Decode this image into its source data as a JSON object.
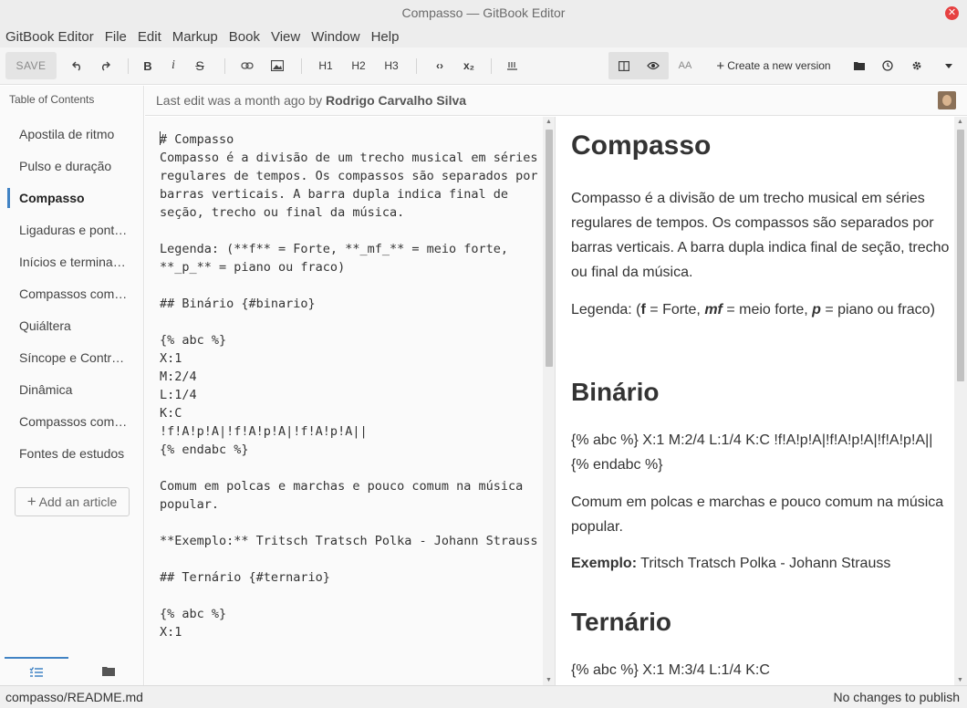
{
  "window": {
    "title": "Compasso — GitBook Editor"
  },
  "menu": [
    "GitBook Editor",
    "File",
    "Edit",
    "Markup",
    "Book",
    "View",
    "Window",
    "Help"
  ],
  "toolbar": {
    "save_label": "SAVE",
    "h1": "H1",
    "h2": "H2",
    "h3": "H3",
    "create_version_label": "Create a new version"
  },
  "sidebar": {
    "title": "Table of Contents",
    "items": [
      {
        "label": "Apostila de ritmo"
      },
      {
        "label": "Pulso e duração"
      },
      {
        "label": "Compasso"
      },
      {
        "label": "Ligaduras e pont…"
      },
      {
        "label": "Inícios e termina…"
      },
      {
        "label": "Compassos com…"
      },
      {
        "label": "Quiáltera"
      },
      {
        "label": "Síncope e Contr…"
      },
      {
        "label": "Dinâmica"
      },
      {
        "label": "Compassos com…"
      },
      {
        "label": "Fontes de estudos"
      }
    ],
    "active_index": 2,
    "add_article_label": "Add an article"
  },
  "editbar": {
    "prefix": "Last edit was a month ago by",
    "author": "Rodrigo Carvalho Silva"
  },
  "editor": {
    "first_line": "# Compasso",
    "text": "\nCompasso é a divisão de um trecho musical em séries regulares de tempos. Os compassos são separados por barras verticais. A barra dupla indica final de seção, trecho ou final da música.\n\nLegenda: (**f** = Forte, **_mf_** = meio forte, **_p_** = piano ou fraco)\n\n## Binário {#binario}\n\n{% abc %}\nX:1\nM:2/4\nL:1/4\nK:C\n!f!A!p!A|!f!A!p!A|!f!A!p!A||\n{% endabc %}\n\nComum em polcas e marchas e pouco comum na música popular.\n\n**Exemplo:** Tritsch Tratsch Polka - Johann Strauss\n\n## Ternário {#ternario}\n\n{% abc %}\nX:1"
  },
  "preview": {
    "h1": "Compasso",
    "p1": "Compasso é a divisão de um trecho musical em séries regulares de tempos. Os compassos são separados por barras verticais. A barra dupla indica final de seção, trecho ou final da música.",
    "legend": {
      "a": "Legenda: (",
      "f": "f",
      "b": " = Forte, ",
      "mf": "mf",
      "c": " = meio forte, ",
      "p": "p",
      "d": " = piano ou fraco)"
    },
    "h2_binario": "Binário",
    "abc_binario": "{% abc %} X:1 M:2/4 L:1/4 K:C !f!A!p!A|!f!A!p!A|!f!A!p!A|| {% endabc %}",
    "p_binario": "Comum em polcas e marchas e pouco comum na música popular.",
    "exemplo_label": "Exemplo:",
    "exemplo_text": " Tritsch Tratsch Polka - Johann Strauss",
    "h2_ternario": "Ternário",
    "abc_ternario": "{% abc %} X:1 M:3/4 L:1/4 K:C"
  },
  "status": {
    "path": "compasso/README.md",
    "publish": "No changes to publish"
  },
  "colors": {
    "accent": "#4183c4",
    "close": "#e64141"
  }
}
